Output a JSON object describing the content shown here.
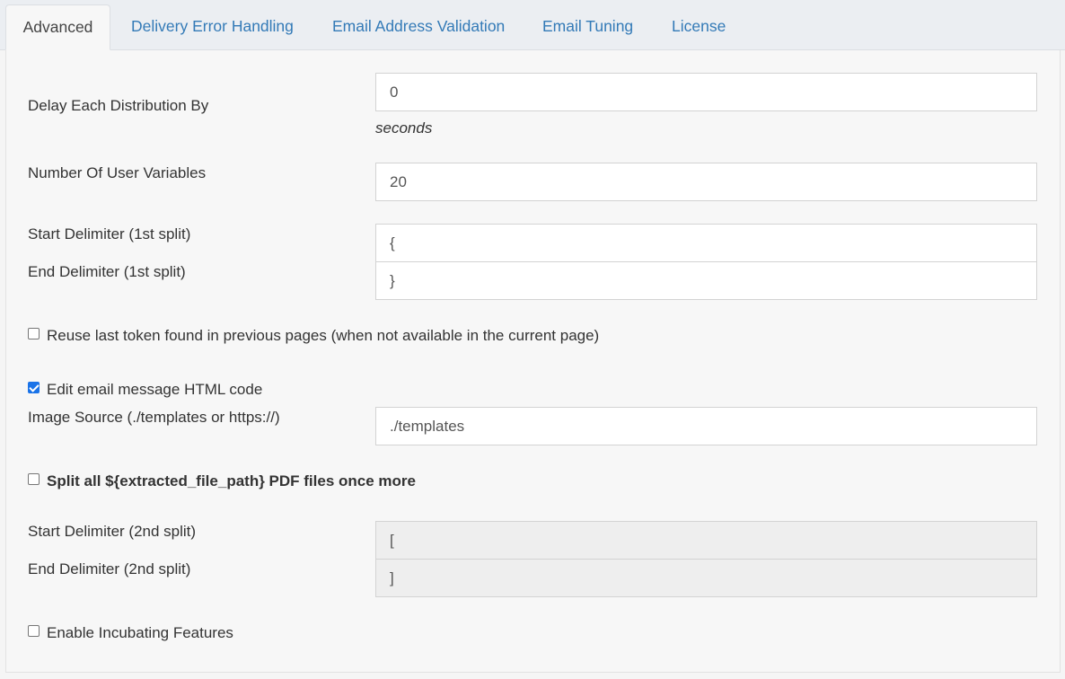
{
  "tabs": [
    {
      "label": "Advanced",
      "active": true
    },
    {
      "label": "Delivery Error Handling",
      "active": false
    },
    {
      "label": "Email Address Validation",
      "active": false
    },
    {
      "label": "Email Tuning",
      "active": false
    },
    {
      "label": "License",
      "active": false
    }
  ],
  "form": {
    "delay": {
      "label": "Delay Each Distribution By",
      "value": "0",
      "unit": "seconds"
    },
    "user_vars": {
      "label": "Number Of User Variables",
      "value": "20"
    },
    "start_delim_1": {
      "label": "Start Delimiter (1st split)",
      "value": "{"
    },
    "end_delim_1": {
      "label": "End Delimiter (1st split)",
      "value": "}"
    },
    "reuse_token": {
      "label": "Reuse last token found in previous pages (when not available in the current page)",
      "checked": false
    },
    "edit_html": {
      "label": "Edit email message HTML code",
      "checked": true
    },
    "image_source": {
      "label": "Image Source (./templates or https://)",
      "value": "./templates"
    },
    "split_again": {
      "label": "Split all ${extracted_file_path} PDF files once more",
      "checked": false
    },
    "start_delim_2": {
      "label": "Start Delimiter (2nd split)",
      "value": "[",
      "disabled": true
    },
    "end_delim_2": {
      "label": "End Delimiter (2nd split)",
      "value": "]",
      "disabled": true
    },
    "incubating": {
      "label": "Enable Incubating Features",
      "checked": false
    }
  },
  "colors": {
    "link": "#337ab7",
    "checkbox_checked": "#1a73e8",
    "disabled_field": "#eeeeee"
  }
}
